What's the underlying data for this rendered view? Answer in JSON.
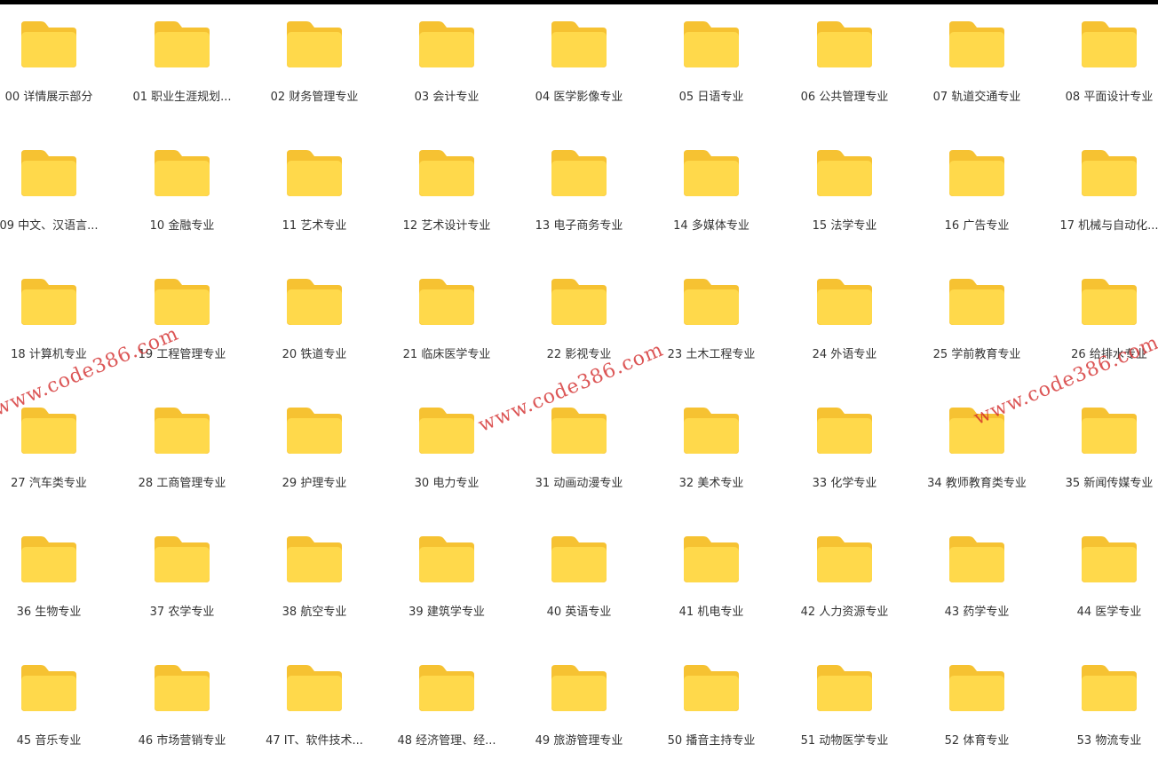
{
  "colors": {
    "folder_back": "#F6C232",
    "folder_front": "#FFD94B",
    "label_text": "#333333",
    "watermark": "#D22828"
  },
  "folders": [
    "00 详情展示部分",
    "01 职业生涯规划...",
    "02 财务管理专业",
    "03 会计专业",
    "04 医学影像专业",
    "05 日语专业",
    "06 公共管理专业",
    "07 轨道交通专业",
    "08 平面设计专业",
    "09 中文、汉语言...",
    "10 金融专业",
    "11 艺术专业",
    "12 艺术设计专业",
    "13 电子商务专业",
    "14 多媒体专业",
    "15 法学专业",
    "16 广告专业",
    "17 机械与自动化...",
    "18 计算机专业",
    "19 工程管理专业",
    "20 铁道专业",
    "21 临床医学专业",
    "22 影视专业",
    "23 土木工程专业",
    "24 外语专业",
    "25 学前教育专业",
    "26 给排水专业",
    "27 汽车类专业",
    "28 工商管理专业",
    "29 护理专业",
    "30 电力专业",
    "31 动画动漫专业",
    "32 美术专业",
    "33 化学专业",
    "34 教师教育类专业",
    "35 新闻传媒专业",
    "36 生物专业",
    "37 农学专业",
    "38 航空专业",
    "39 建筑学专业",
    "40 英语专业",
    "41 机电专业",
    "42 人力资源专业",
    "43 药学专业",
    "44 医学专业",
    "45 音乐专业",
    "46 市场营销专业",
    "47 IT、软件技术...",
    "48 经济管理、经...",
    "49 旅游管理专业",
    "50 播音主持专业",
    "51 动物医学专业",
    "52 体育专业",
    "53 物流专业"
  ],
  "watermarks": [
    "www.code386.com",
    "www.code386.com",
    "www.code386.com"
  ]
}
